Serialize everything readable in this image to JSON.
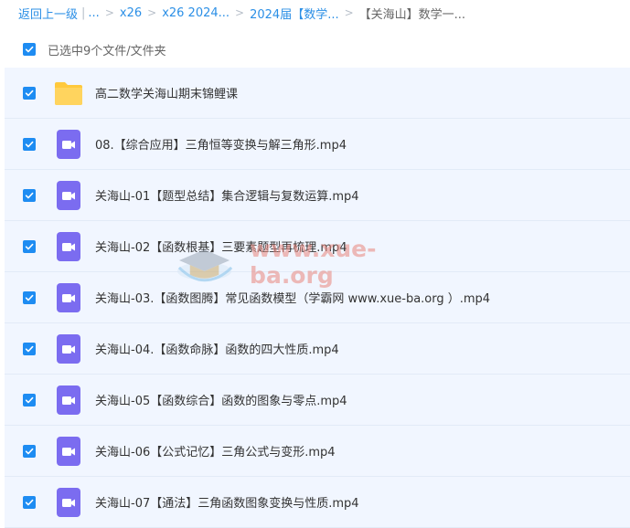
{
  "breadcrumb": {
    "back": "返回上一级",
    "ellipsis": "...",
    "items": [
      "x26",
      "x26 2024...",
      "2024届【数学...",
      "【关海山】数学一..."
    ],
    "separator": ">",
    "bar": "|"
  },
  "selection": {
    "text": "已选中9个文件/文件夹"
  },
  "files": [
    {
      "name": "高二数学关海山期末锦鲤课",
      "type": "folder",
      "icon": "folder-icon"
    },
    {
      "name": "08.【综合应用】三角恒等变换与解三角形.mp4",
      "type": "video",
      "icon": "video-file-icon"
    },
    {
      "name": "关海山-01【题型总结】集合逻辑与复数运算.mp4",
      "type": "video",
      "icon": "video-file-icon"
    },
    {
      "name": "关海山-02【函数根基】三要素题型再梳理.mp4",
      "type": "video",
      "icon": "video-file-icon"
    },
    {
      "name": "关海山-03.【函数图腾】常见函数模型（学霸网 www.xue-ba.org ）.mp4",
      "type": "video",
      "icon": "video-file-icon"
    },
    {
      "name": "关海山-04.【函数命脉】函数的四大性质.mp4",
      "type": "video",
      "icon": "video-file-icon"
    },
    {
      "name": "关海山-05【函数综合】函数的图象与零点.mp4",
      "type": "video",
      "icon": "video-file-icon"
    },
    {
      "name": "关海山-06【公式记忆】三角公式与变形.mp4",
      "type": "video",
      "icon": "video-file-icon"
    },
    {
      "name": "关海山-07【通法】三角函数图象变换与性质.mp4",
      "type": "video",
      "icon": "video-file-icon"
    }
  ],
  "watermark": {
    "text": "www.xue-ba.org"
  },
  "colors": {
    "accent": "#1e8cf2",
    "row_bg": "#f1f6ff",
    "folder": "#ffc93c",
    "video": "#7b6cf0"
  }
}
